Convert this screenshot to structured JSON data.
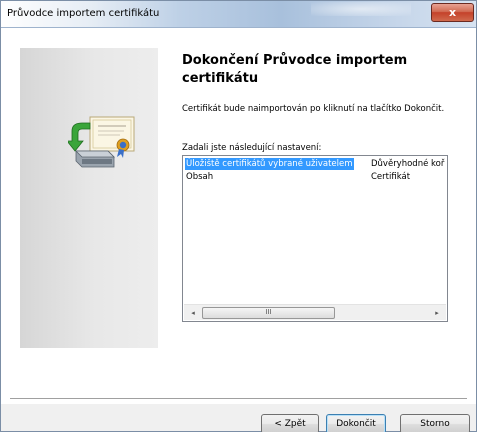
{
  "window": {
    "title": "Průvodce importem certifikátu",
    "close_symbol": "x"
  },
  "main": {
    "heading": "Dokončení Průvodce importem certifikátu",
    "description": "Certifikát bude naimportován po kliknutí na tlačítko Dokončit.",
    "settings_label": "Zadali jste následující nastavení:",
    "settings": [
      {
        "name": "Úložiště certifikátů vybrané uživatelem",
        "value": "Důvěryhodné koř"
      },
      {
        "name": "Obsah",
        "value": "Certifikát"
      }
    ],
    "scrollbar": {
      "left_arrow": "◂",
      "right_arrow": "▸",
      "thumb_grip": "III"
    }
  },
  "buttons": {
    "back": "< Zpět",
    "finish": "Dokončit",
    "cancel": "Storno"
  },
  "icons": {
    "wizard_icon": "certificate-import-icon"
  },
  "colors": {
    "selection": "#3399ff",
    "close_button": "#c4412a"
  }
}
